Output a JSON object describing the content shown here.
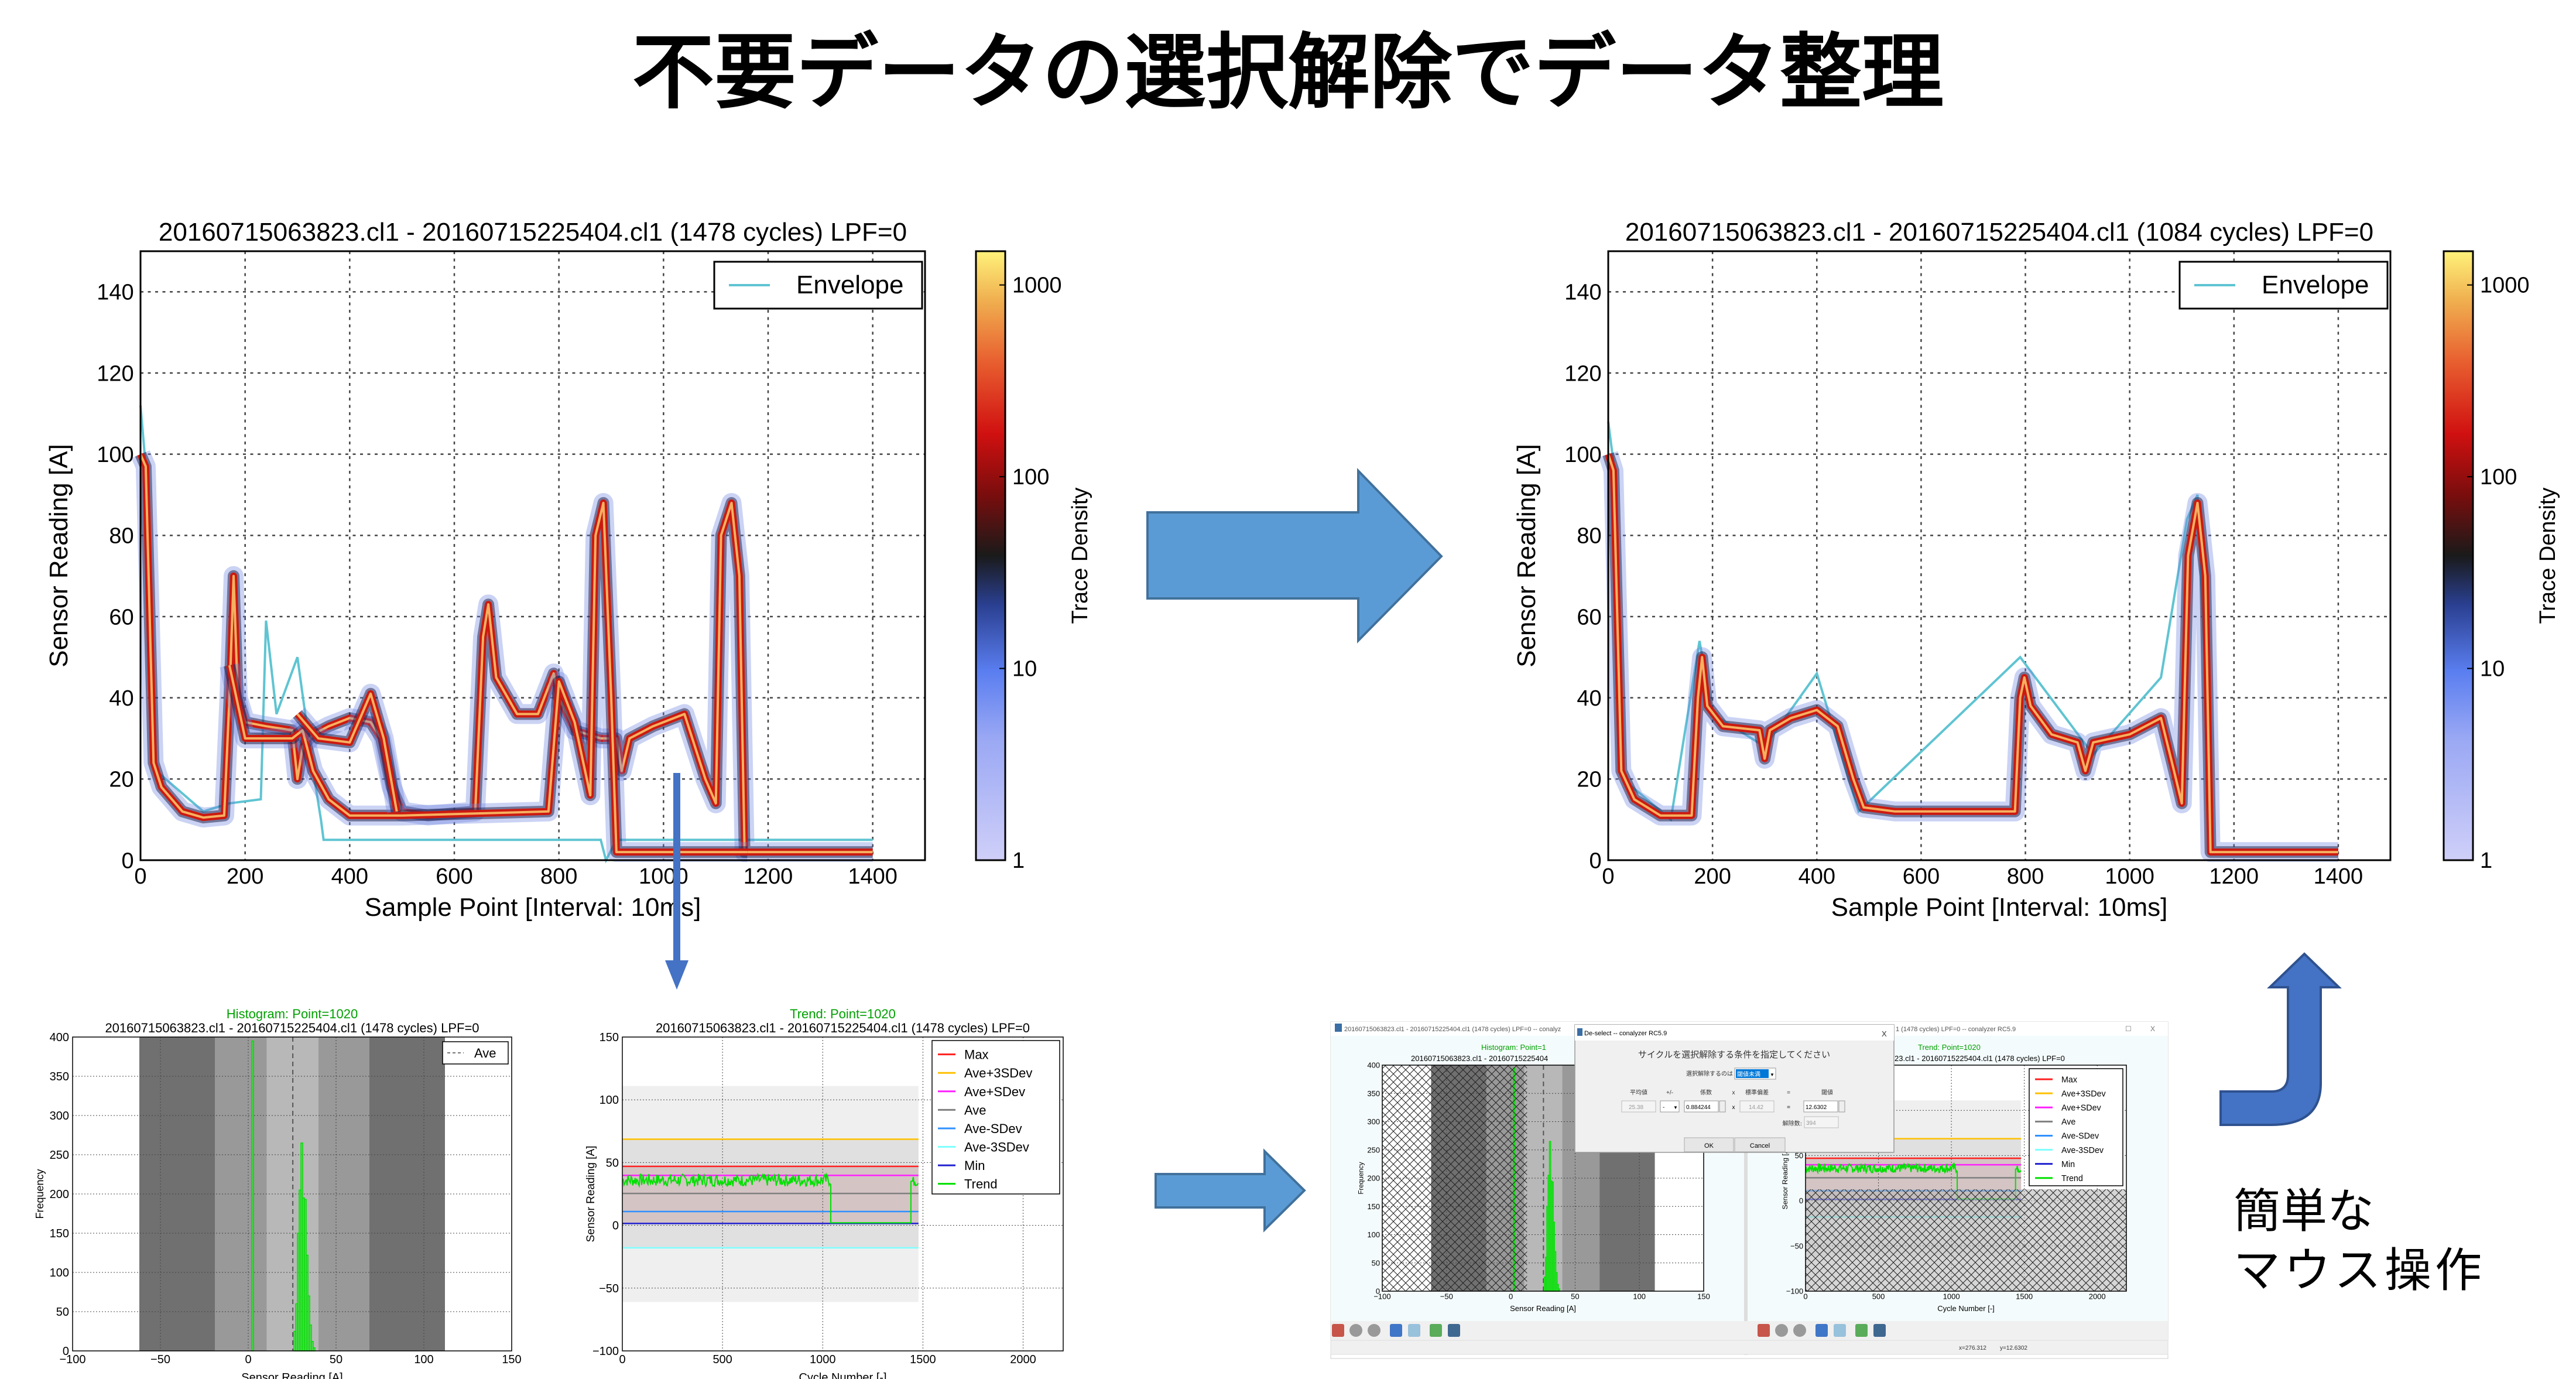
{
  "slide": {
    "title": "不要データの選択解除でデータ整理",
    "caption_line1": "簡単な",
    "caption_line2": "マウス操作"
  },
  "colors": {
    "arrow_fill": "#5b9bd5",
    "arrow_dark": "#4472c4",
    "trend_green": "#00e000",
    "title_green": "#00a000",
    "envelope": "#5fc4d2"
  },
  "icons": [
    "arrow-right-icon",
    "arrow-down-icon",
    "arrow-up-turn-icon",
    "home-icon",
    "back-icon",
    "forward-icon",
    "pan-icon",
    "zoom-icon",
    "configure-icon",
    "save-icon"
  ],
  "chart_data": [
    {
      "id": "density_before",
      "type": "line",
      "title": "20160715063823.cl1 - 20160715225404.cl1 (1478 cycles) LPF=0",
      "xlabel": "Sample Point [Interval: 10ms]",
      "ylabel": "Sensor Reading [A]",
      "xlim": [
        0,
        1500
      ],
      "ylim": [
        0,
        150
      ],
      "xticks": [
        "0",
        "200",
        "400",
        "600",
        "800",
        "1000",
        "1200",
        "1400"
      ],
      "yticks": [
        "0",
        "20",
        "40",
        "60",
        "80",
        "100",
        "120",
        "140"
      ],
      "grid": true,
      "legend": {
        "placement": "top-right",
        "entries": [
          "Envelope"
        ]
      },
      "colorbar": {
        "label": "Trace Density",
        "scale": "log",
        "range": [
          1,
          1500
        ],
        "ticks": [
          "1",
          "10",
          "100",
          "1000"
        ]
      },
      "traces": [
        [
          [
            0,
            100
          ],
          [
            10,
            97
          ],
          [
            25,
            24
          ],
          [
            40,
            18
          ],
          [
            80,
            12
          ],
          [
            120,
            10.5
          ],
          [
            160,
            11
          ],
          [
            170,
            40
          ],
          [
            178,
            70
          ],
          [
            186,
            40
          ],
          [
            200,
            34
          ],
          [
            240,
            33
          ],
          [
            290,
            32
          ],
          [
            300,
            20
          ],
          [
            310,
            28
          ],
          [
            330,
            31
          ],
          [
            360,
            33
          ],
          [
            400,
            35
          ],
          [
            440,
            34
          ],
          [
            460,
            30
          ],
          [
            480,
            18
          ],
          [
            500,
            12
          ],
          [
            550,
            11
          ],
          [
            640,
            12
          ],
          [
            655,
            55
          ],
          [
            665,
            63
          ],
          [
            680,
            45
          ],
          [
            720,
            36
          ],
          [
            760,
            36
          ],
          [
            790,
            46
          ],
          [
            800,
            40
          ],
          [
            830,
            32
          ],
          [
            880,
            30
          ],
          [
            910,
            30
          ],
          [
            920,
            22
          ],
          [
            935,
            30
          ],
          [
            980,
            33
          ],
          [
            1040,
            36
          ],
          [
            1080,
            20
          ],
          [
            1100,
            14
          ],
          [
            1110,
            80
          ],
          [
            1130,
            88
          ],
          [
            1145,
            70
          ],
          [
            1155,
            2
          ],
          [
            1400,
            2
          ]
        ],
        [
          [
            170,
            48
          ],
          [
            200,
            30
          ],
          [
            290,
            30
          ],
          [
            310,
            32
          ],
          [
            330,
            22
          ],
          [
            360,
            15
          ],
          [
            400,
            11
          ],
          [
            500,
            11
          ],
          [
            780,
            12
          ],
          [
            800,
            44
          ],
          [
            830,
            34
          ],
          [
            860,
            16
          ],
          [
            870,
            80
          ],
          [
            885,
            88
          ],
          [
            900,
            40
          ],
          [
            910,
            2
          ],
          [
            1160,
            2
          ]
        ],
        [
          [
            300,
            36
          ],
          [
            340,
            30
          ],
          [
            400,
            29
          ],
          [
            440,
            41
          ],
          [
            465,
            30
          ],
          [
            490,
            12
          ]
        ]
      ],
      "envelope": [
        [
          0,
          112
        ],
        [
          8,
          100
        ],
        [
          30,
          22
        ],
        [
          120,
          12
        ],
        [
          170,
          14
        ],
        [
          230,
          15
        ],
        [
          240,
          59
        ],
        [
          260,
          36
        ],
        [
          300,
          50
        ],
        [
          330,
          22
        ],
        [
          345,
          10
        ],
        [
          350,
          5
        ],
        [
          880,
          5
        ],
        [
          890,
          0
        ],
        [
          910,
          5
        ],
        [
          1000,
          5
        ],
        [
          1150,
          5
        ],
        [
          1400,
          5
        ]
      ]
    },
    {
      "id": "density_after",
      "type": "line",
      "title": "20160715063823.cl1 - 20160715225404.cl1 (1084 cycles) LPF=0",
      "xlabel": "Sample Point [Interval: 10ms]",
      "ylabel": "Sensor Reading [A]",
      "xlim": [
        0,
        1500
      ],
      "ylim": [
        0,
        150
      ],
      "xticks": [
        "0",
        "200",
        "400",
        "600",
        "800",
        "1000",
        "1200",
        "1400"
      ],
      "yticks": [
        "0",
        "20",
        "40",
        "60",
        "80",
        "100",
        "120",
        "140"
      ],
      "grid": true,
      "legend": {
        "placement": "top-right",
        "entries": [
          "Envelope"
        ]
      },
      "colorbar": {
        "label": "Trace Density",
        "scale": "log",
        "range": [
          1,
          1500
        ],
        "ticks": [
          "1",
          "10",
          "100",
          "1000"
        ]
      },
      "traces": [
        [
          [
            0,
            100
          ],
          [
            10,
            96
          ],
          [
            25,
            22
          ],
          [
            50,
            15
          ],
          [
            100,
            11
          ],
          [
            160,
            11
          ],
          [
            172,
            40
          ],
          [
            180,
            50
          ],
          [
            190,
            38
          ],
          [
            220,
            33
          ],
          [
            290,
            32
          ],
          [
            300,
            25
          ],
          [
            310,
            32
          ],
          [
            350,
            35
          ],
          [
            400,
            37
          ],
          [
            440,
            33
          ],
          [
            470,
            20
          ],
          [
            490,
            13
          ],
          [
            550,
            12
          ],
          [
            780,
            12
          ],
          [
            790,
            40
          ],
          [
            798,
            45
          ],
          [
            810,
            38
          ],
          [
            850,
            31
          ],
          [
            900,
            29
          ],
          [
            915,
            22
          ],
          [
            930,
            29
          ],
          [
            1000,
            31
          ],
          [
            1060,
            35
          ],
          [
            1085,
            22
          ],
          [
            1100,
            14
          ],
          [
            1112,
            75
          ],
          [
            1130,
            88
          ],
          [
            1145,
            70
          ],
          [
            1155,
            2
          ],
          [
            1400,
            2
          ]
        ]
      ],
      "envelope": [
        [
          0,
          108
        ],
        [
          10,
          98
        ],
        [
          28,
          20
        ],
        [
          120,
          10
        ],
        [
          175,
          54
        ],
        [
          200,
          36
        ],
        [
          300,
          28
        ],
        [
          400,
          46
        ],
        [
          480,
          12
        ],
        [
          790,
          50
        ],
        [
          930,
          26
        ],
        [
          1060,
          45
        ],
        [
          1110,
          84
        ],
        [
          1130,
          90
        ],
        [
          1160,
          2
        ],
        [
          1400,
          2
        ]
      ]
    },
    {
      "id": "histogram",
      "type": "bar",
      "suptitle": "Histogram: Point=1020",
      "title": "20160715063823.cl1 - 20160715225404.cl1 (1478 cycles) LPF=0",
      "xlabel": "Sensor Reading [A]",
      "ylabel": "Frequency",
      "xlim": [
        -100,
        150
      ],
      "ylim": [
        0,
        400
      ],
      "xticks": [
        "-100",
        "-50",
        "0",
        "50",
        "100",
        "150"
      ],
      "yticks": [
        "0",
        "50",
        "100",
        "150",
        "200",
        "250",
        "300",
        "350",
        "400"
      ],
      "legend": {
        "placement": "top-right",
        "entries": [
          "Ave"
        ]
      },
      "ave": 25.38,
      "bands": [
        [
          -62,
          -19,
          "#707070"
        ],
        [
          -19,
          10.6,
          "#999999"
        ],
        [
          10.6,
          40,
          "#b8b8b8"
        ],
        [
          40,
          69,
          "#999999"
        ],
        [
          69,
          112,
          "#707070"
        ]
      ],
      "bins": [
        [
          2,
          395
        ],
        [
          26,
          25
        ],
        [
          27,
          60
        ],
        [
          28,
          150
        ],
        [
          29,
          205
        ],
        [
          30,
          265
        ],
        [
          31,
          195
        ],
        [
          32,
          193
        ],
        [
          33,
          122
        ],
        [
          34,
          70
        ],
        [
          35,
          33
        ],
        [
          36,
          12
        ],
        [
          37,
          4
        ]
      ]
    },
    {
      "id": "trend",
      "type": "line",
      "suptitle": "Trend: Point=1020",
      "title": "20160715063823.cl1 - 20160715225404.cl1 (1478 cycles) LPF=0",
      "xlabel": "Cycle Number [-]",
      "ylabel": "Sensor Reading [A]",
      "xlim": [
        0,
        2200
      ],
      "ylim": [
        -100,
        150
      ],
      "xticks": [
        "0",
        "500",
        "1000",
        "1500",
        "2000"
      ],
      "yticks": [
        "-100",
        "-50",
        "0",
        "50",
        "100",
        "150"
      ],
      "legend": {
        "placement": "top-right"
      },
      "series": [
        {
          "name": "Max",
          "value": 47,
          "color": "#ff2020"
        },
        {
          "name": "Ave+3SDev",
          "value": 68.6,
          "color": "#ffc000"
        },
        {
          "name": "Ave+SDev",
          "value": 39.8,
          "color": "#ff20ff"
        },
        {
          "name": "Ave",
          "value": 25.4,
          "color": "#808080"
        },
        {
          "name": "Ave-SDev",
          "value": 11,
          "color": "#3090ff"
        },
        {
          "name": "Ave-3SDev",
          "value": -17.9,
          "color": "#80ffff"
        },
        {
          "name": "Min",
          "value": 1.5,
          "color": "#2020d0"
        },
        {
          "name": "Trend",
          "color": "#00e000",
          "segments": [
            {
              "from": 0,
              "to": 1040,
              "level": 36,
              "noise": 5
            },
            {
              "from": 1040,
              "to": 1440,
              "level": 2,
              "noise": 0
            },
            {
              "from": 1440,
              "to": 1478,
              "level": 35,
              "noise": 4
            }
          ]
        }
      ],
      "band_outer": [
        -61,
        111
      ],
      "band_inner": [
        -17.9,
        68.6
      ],
      "band_sigma": [
        1.5,
        47
      ],
      "cycles": 1478
    }
  ],
  "app": {
    "window_left_title": "20160715063823.cl1 - 20160715225404.cl1 (1478 cycles) LPF=0 -- conalyz",
    "window_right_title": "1 (1478 cycles) LPF=0 -- conalyzer RC5.9",
    "hist_suptitle": "Histogram: Point=1",
    "hist_title": "20160715063823.cl1 - 20160715225404",
    "trend_suptitle": "Trend: Point=1020",
    "trend_title": "23.cl1 - 20160715225404.cl1 (1478 cycles) LPF=0",
    "threshold": 12.6302,
    "status_x": "x=276.312",
    "status_y": "y=12.6302",
    "dialog": {
      "title": "De-select -- conalyzer RC5.9",
      "close": "X",
      "heading": "サイクルを選択解除する条件を指定してください",
      "mode_label": "選択解除するのは",
      "mode_value": "閾値未満",
      "col_mean": "平均値",
      "col_pm": "+/-",
      "col_coef": "係数",
      "col_times": "x",
      "col_sd": "標準偏差",
      "col_eq": "=",
      "col_thr": "閾値",
      "mean": "25.38",
      "sign": "-",
      "coef": "0.884244",
      "sd": "14.42",
      "thr": "12.6302",
      "count_label": "解除数:",
      "count": "394",
      "ok": "OK",
      "cancel": "Cancel"
    }
  }
}
